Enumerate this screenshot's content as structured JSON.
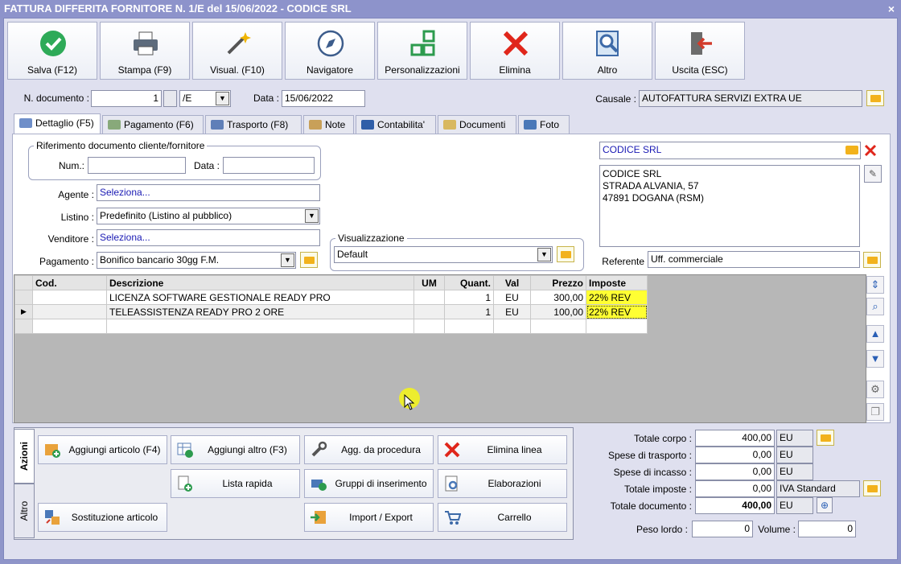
{
  "window": {
    "title": "FATTURA DIFFERITA FORNITORE N. 1/E del 15/06/2022 - CODICE SRL",
    "close_glyph": "×"
  },
  "toolbar": {
    "save": "Salva (F12)",
    "print": "Stampa (F9)",
    "view": "Visual. (F10)",
    "navigator": "Navigatore",
    "customize": "Personalizzazioni",
    "delete": "Elimina",
    "other": "Altro",
    "exit": "Uscita (ESC)"
  },
  "header": {
    "doc_number_label": "N. documento :",
    "doc_number": "1",
    "doc_series": "/E",
    "date_label": "Data :",
    "date": "15/06/2022",
    "causale_label": "Causale :",
    "causale": "AUTOFATTURA SERVIZI EXTRA UE"
  },
  "tabs": [
    "Dettaglio (F5)",
    "Pagamento (F6)",
    "Trasporto (F8)",
    "Note",
    "Contabilita'",
    "Documenti",
    "Foto"
  ],
  "detail": {
    "ref_group_label": "Riferimento documento cliente/fornitore",
    "num_label": "Num.:",
    "num_value": "",
    "data_label": "Data :",
    "data_value": "",
    "agent_label": "Agente :",
    "agent_value": "Seleziona...",
    "listino_label": "Listino :",
    "listino_value": "Predefinito (Listino al pubblico)",
    "seller_label": "Venditore :",
    "seller_value": "Seleziona...",
    "payment_label": "Pagamento :",
    "payment_value": "Bonifico bancario 30gg F.M.",
    "view_group_label": "Visualizzazione",
    "view_value": "Default",
    "supplier_name": "CODICE SRL",
    "address_lines": [
      "CODICE SRL",
      "STRADA ALVANIA, 57",
      "47891 DOGANA (RSM)"
    ],
    "referente_label": "Referente",
    "referente_value": "Uff. commerciale"
  },
  "grid": {
    "columns": [
      "Cod.",
      "Descrizione",
      "UM",
      "Quant.",
      "Val",
      "Prezzo",
      "Imposte"
    ],
    "rows": [
      {
        "cod": "",
        "desc": "LICENZA SOFTWARE GESTIONALE READY PRO",
        "um": "",
        "qty": "1",
        "val": "EU",
        "price": "300,00",
        "tax": "22% REV"
      },
      {
        "cod": "",
        "desc": "TELEASSISTENZA READY PRO 2 ORE",
        "um": "",
        "qty": "1",
        "val": "EU",
        "price": "100,00",
        "tax": "22% REV"
      },
      {
        "cod": "",
        "desc": "",
        "um": "",
        "qty": "",
        "val": "",
        "price": "",
        "tax": ""
      }
    ],
    "highlight_color": "#ffff33"
  },
  "actions": {
    "tab_actions": "Azioni",
    "tab_other": "Altro",
    "add_article": "Aggiungi articolo (F4)",
    "add_other": "Aggiungi altro (F3)",
    "from_procedure": "Agg. da procedura",
    "delete_line": "Elimina linea",
    "quick_list": "Lista rapida",
    "insert_groups": "Gruppi di inserimento",
    "processing": "Elaborazioni",
    "replace_article": "Sostituzione articolo",
    "import_export": "Import / Export",
    "cart": "Carrello"
  },
  "totals": {
    "body_label": "Totale corpo :",
    "body_value": "400,00",
    "shipping_label": "Spese di trasporto :",
    "shipping_value": "0,00",
    "collection_label": "Spese di incasso :",
    "collection_value": "0,00",
    "tax_label": "Totale imposte :",
    "tax_value": "0,00",
    "tax_type": "IVA Standard",
    "doc_total_label": "Totale documento :",
    "doc_total_value": "400,00",
    "currency": "EU",
    "gross_weight_label": "Peso lordo :",
    "gross_weight_value": "0",
    "volume_label": "Volume :",
    "volume_value": "0"
  }
}
